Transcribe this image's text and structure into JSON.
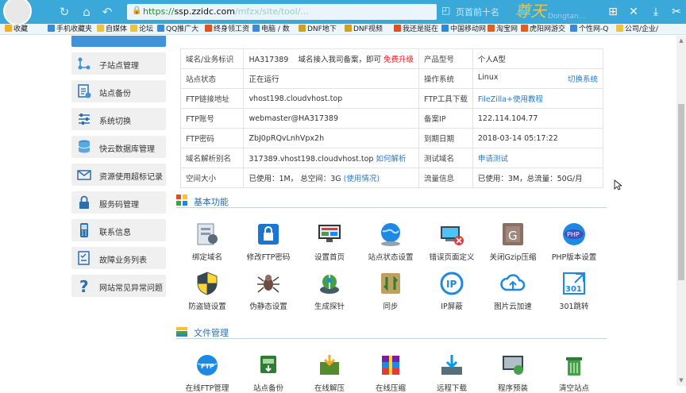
{
  "browser": {
    "url_domain": "ssp.zzidc.com",
    "url_scheme": "https://",
    "url_path": "/mfzx/site/tool/...",
    "tab_title": "页首前十名",
    "logo_text": "尊天",
    "logo_sub": "Dongtan..."
  },
  "bookmarks": [
    {
      "label": "收藏",
      "color": "#f0b020"
    },
    {
      "label": "手机收藏夹",
      "color": "#3a8ad8"
    },
    {
      "label": "自媒体",
      "color": "#f0c040"
    },
    {
      "label": "论坛",
      "color": "#f0c040"
    },
    {
      "label": "QQ推广大",
      "color": "#3a8ad8"
    },
    {
      "label": "终身领工资",
      "color": "#e05020"
    },
    {
      "label": "电脑 / 数",
      "color": "#3a8ad8"
    },
    {
      "label": "DNF地下",
      "color": "#d0a020"
    },
    {
      "label": "DNF视频",
      "color": "#d0a020"
    },
    {
      "label": "我还是挺在",
      "color": "#e05020"
    },
    {
      "label": "中国移动网",
      "color": "#2a8ad8"
    },
    {
      "label": "淘宝网",
      "color": "#e06020"
    },
    {
      "label": "虎阳网游交",
      "color": "#e06020"
    },
    {
      "label": "个性网-Q",
      "color": "#3a8ad8"
    },
    {
      "label": "公司/企业/",
      "color": "#f0c040"
    }
  ],
  "sidebar": {
    "items": [
      {
        "label": "子站点管理",
        "icon": "sitemap-icon"
      },
      {
        "label": "站点备份",
        "icon": "backup-icon"
      },
      {
        "label": "系统切换",
        "icon": "switch-icon"
      },
      {
        "label": "快云数据库管理",
        "icon": "database-icon"
      },
      {
        "label": "资源使用超标记录",
        "icon": "mail-warning-icon"
      },
      {
        "label": "服务码管理",
        "icon": "lock-icon"
      },
      {
        "label": "联系信息",
        "icon": "phone-icon"
      },
      {
        "label": "故障业务列表",
        "icon": "fault-list-icon"
      },
      {
        "label": "网站常见异常问题",
        "icon": "question-icon"
      }
    ]
  },
  "info": {
    "rows": [
      {
        "k1": "域名/业务标识",
        "v1": "HA317389",
        "v1_note": "域名接入我司备案，即可",
        "v1_link": "免费升级",
        "k2": "产品型号",
        "v2": "个人A型",
        "v2_link": ""
      },
      {
        "k1": "站点状态",
        "v1": "正在运行",
        "v1_note": "",
        "v1_link": "",
        "k2": "操作系统",
        "v2": "Linux",
        "v2_link": "切换系统"
      },
      {
        "k1": "FTP链接地址",
        "v1": "vhost198.cloudvhost.top",
        "v1_note": "",
        "v1_link": "",
        "k2": "FTP工具下载",
        "v2": "",
        "v2_link": "FileZilla+使用教程"
      },
      {
        "k1": "FTP账号",
        "v1": "webmaster@HA317389",
        "v1_note": "",
        "v1_link": "",
        "k2": "备案IP",
        "v2": "122.114.104.77",
        "v2_link": ""
      },
      {
        "k1": "FTP密码",
        "v1": "ZbJ0pRQvLnhVpx2h",
        "v1_note": "",
        "v1_link": "",
        "k2": "到期日期",
        "v2": "2018-03-14 05:17:22",
        "v2_link": ""
      },
      {
        "k1": "域名解析别名",
        "v1": "317389.vhost198.cloudvhost.top",
        "v1_note": "",
        "v1_link": "如何解析",
        "k2": "测试域名",
        "v2": "",
        "v2_link": "申请测试"
      },
      {
        "k1": "空间大小",
        "v1": "已使用：1M， 总空间：3G",
        "v1_note": "",
        "v1_link": "(使用情况)",
        "k2": "流量信息",
        "v2": "已使用：3M，总流量：50G/月",
        "v2_link": ""
      }
    ]
  },
  "basic": {
    "title": "基本功能",
    "items": [
      {
        "label": "绑定域名",
        "icon": "bind-domain-icon"
      },
      {
        "label": "修改FTP密码",
        "icon": "ftp-lock-icon"
      },
      {
        "label": "设置首页",
        "icon": "homepage-icon"
      },
      {
        "label": "站点状态设置",
        "icon": "globe-icon"
      },
      {
        "label": "错误页面定义",
        "icon": "error-page-icon"
      },
      {
        "label": "关闭Gzip压缩",
        "icon": "gzip-icon"
      },
      {
        "label": "PHP版本设置",
        "icon": "php-icon"
      },
      {
        "label": "防盗链设置",
        "icon": "shield-icon"
      },
      {
        "label": "伪静态设置",
        "icon": "spider-icon"
      },
      {
        "label": "生成探针",
        "icon": "probe-icon"
      },
      {
        "label": "同步",
        "icon": "sync-icon"
      },
      {
        "label": "IP屏蔽",
        "icon": "ip-icon"
      },
      {
        "label": "图片云加速",
        "icon": "cloud-icon"
      },
      {
        "label": "301跳转",
        "icon": "redirect-301-icon"
      }
    ]
  },
  "files": {
    "title": "文件管理",
    "items": [
      {
        "label": "在线FTP管理",
        "icon": "ftp-globe-icon"
      },
      {
        "label": "站点备份",
        "icon": "site-backup-icon"
      },
      {
        "label": "在线解压",
        "icon": "unzip-icon"
      },
      {
        "label": "在线压缩",
        "icon": "zip-icon"
      },
      {
        "label": "远程下载",
        "icon": "download-icon"
      },
      {
        "label": "程序预装",
        "icon": "preinstall-icon"
      },
      {
        "label": "清空站点",
        "icon": "trash-icon"
      }
    ]
  }
}
